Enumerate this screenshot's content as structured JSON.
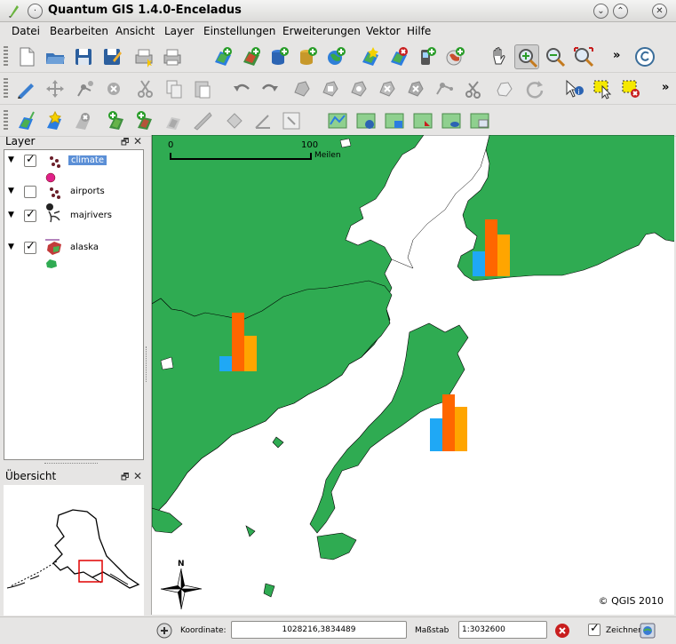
{
  "window": {
    "title": "Quantum GIS 1.4.0-Enceladus",
    "buttons": [
      "minimize",
      "maximize",
      "close"
    ]
  },
  "menubar": [
    "Datei",
    "Bearbeiten",
    "Ansicht",
    "Layer",
    "Einstellungen",
    "Erweiterungen",
    "Vektor",
    "Hilfe"
  ],
  "toolbar_overflow": "»",
  "layers_panel": {
    "title": "Layer",
    "layers": [
      {
        "name": "climate",
        "checked": true,
        "selected": true,
        "icon": "point-layer-icon",
        "symbol_color": "#e0218a"
      },
      {
        "name": "airports",
        "checked": false,
        "selected": false,
        "icon": "point-layer-icon",
        "symbol_color": "#222222"
      },
      {
        "name": "majrivers",
        "checked": true,
        "selected": false,
        "icon": "line-layer-icon",
        "symbol_color": "#9b5aa6"
      },
      {
        "name": "alaska",
        "checked": true,
        "selected": false,
        "icon": "polygon-layer-icon",
        "symbol_color": "#2fab52"
      }
    ]
  },
  "overview_panel": {
    "title": "Übersicht"
  },
  "map": {
    "scalebar": {
      "start": "0",
      "end": "100",
      "unit": "Meilen"
    },
    "north_arrow_label": "N",
    "copyright": "© QGIS 2010",
    "land_color": "#2fab52",
    "chart_colors": [
      "#1fa8f5",
      "#ff6600",
      "#ffa500"
    ]
  },
  "statusbar": {
    "coord_label": "Koordinate:",
    "coord_value": "1028216,3834489",
    "scale_label": "Maßstab",
    "scale_value": "1:3032600",
    "render_label": "Zeichnen",
    "render_checked": true
  }
}
